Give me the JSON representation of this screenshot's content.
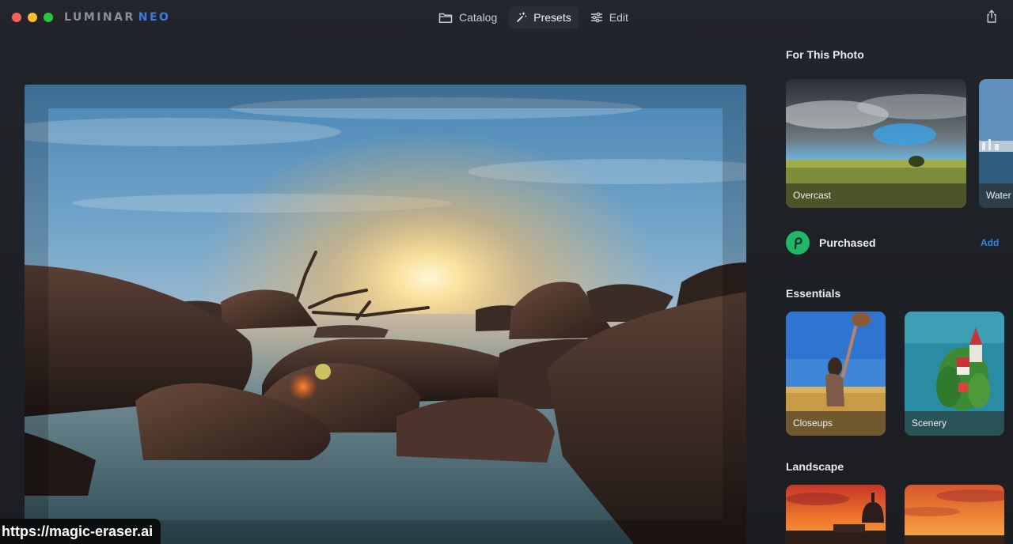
{
  "app": {
    "logo_main": "LUMINAR",
    "logo_accent": "NEO",
    "window_controls": {
      "close_color": "#ff5f57",
      "minimize_color": "#febc2e",
      "maximize_color": "#28c840"
    }
  },
  "nav": {
    "catalog": {
      "label": "Catalog",
      "icon": "folder-icon"
    },
    "presets": {
      "label": "Presets",
      "icon": "magic-wand-icon",
      "active": true
    },
    "edit": {
      "label": "Edit",
      "icon": "sliders-icon"
    },
    "share_icon": "share-icon"
  },
  "panel": {
    "for_this_photo": {
      "title": "For This Photo",
      "items": [
        {
          "label": "Overcast"
        },
        {
          "label": "Water"
        }
      ]
    },
    "purchased": {
      "label": "Purchased",
      "action": "Add"
    },
    "essentials": {
      "title": "Essentials",
      "items": [
        {
          "label": "Closeups"
        },
        {
          "label": "Scenery"
        }
      ]
    },
    "landscape": {
      "title": "Landscape"
    }
  },
  "colors": {
    "accent": "#2f86ec",
    "purchased_badge": "#1fb86a",
    "logo_accent": "#3d7be0"
  },
  "watermark": "https://magic-eraser.ai"
}
